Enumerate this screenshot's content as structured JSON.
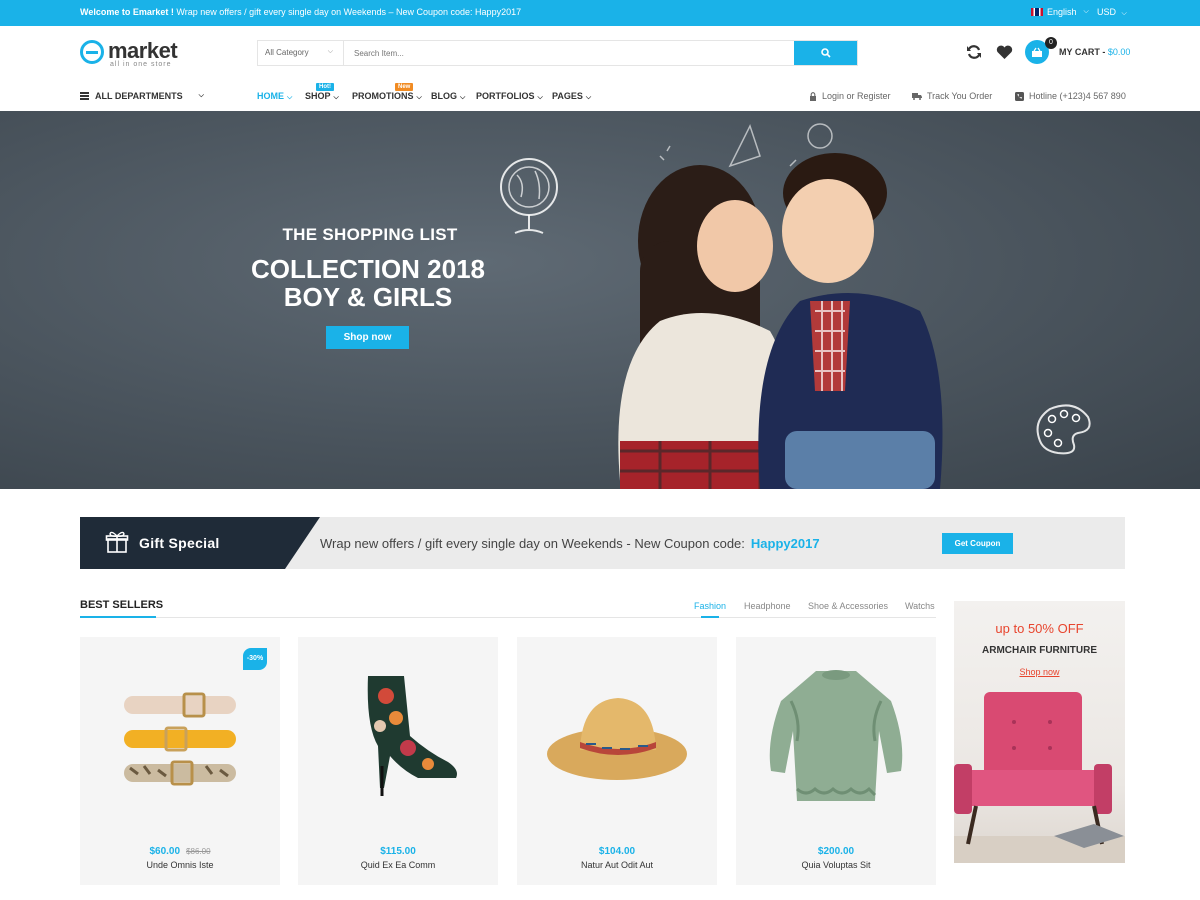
{
  "topbar": {
    "welcome_bold": "Welcome to Emarket !",
    "welcome_text": "Wrap new offers / gift every single day on Weekends – New Coupon code: Happy2017",
    "language": "English",
    "currency": "USD"
  },
  "header": {
    "brand": "market",
    "tagline": "all in one store",
    "search": {
      "category": "All Category",
      "placeholder": "Search Item..."
    },
    "cart": {
      "count": "0",
      "label": "MY CART - ",
      "amount": "$0.00"
    }
  },
  "nav": {
    "all_departments": "ALL DEPARTMENTS",
    "items": [
      {
        "label": "HOME",
        "active": true
      },
      {
        "label": "SHOP",
        "badge": "Hot!"
      },
      {
        "label": "PROMOTIONS",
        "badge": "New"
      },
      {
        "label": "BLOG"
      },
      {
        "label": "PORTFOLIOS"
      },
      {
        "label": "PAGES"
      }
    ],
    "login": "Login or Register",
    "track": "Track You Order",
    "hotline": "Hotline (+123)4 567 890"
  },
  "hero": {
    "subtitle": "THE SHOPPING LIST",
    "title_line1": "COLLECTION 2018",
    "title_line2": "BOY & GIRLS",
    "button": "Shop now"
  },
  "gift": {
    "title": "Gift Special",
    "message": "Wrap new offers / gift every single day on Weekends - New Coupon code:",
    "code": "Happy2017",
    "button": "Get Coupon"
  },
  "bestsellers": {
    "title": "BEST SELLERS",
    "tabs": [
      "Fashion",
      "Headphone",
      "Shoe & Accessories",
      "Watchs"
    ],
    "products": [
      {
        "name": "Unde Omnis Iste",
        "price": "$60.00",
        "old_price": "$86.00",
        "badge": "-30%"
      },
      {
        "name": "Quid Ex Ea Comm",
        "price": "$115.00"
      },
      {
        "name": "Natur Aut Odit Aut",
        "price": "$104.00"
      },
      {
        "name": "Quia Voluptas Sit",
        "price": "$200.00"
      }
    ]
  },
  "promo": {
    "offer": "up to 50% OFF",
    "title": "ARMCHAIR FURNITURE",
    "link": "Shop now"
  },
  "colors": {
    "accent": "#1ab2e8",
    "dark": "#1f2b38",
    "sale": "#e8452e"
  }
}
